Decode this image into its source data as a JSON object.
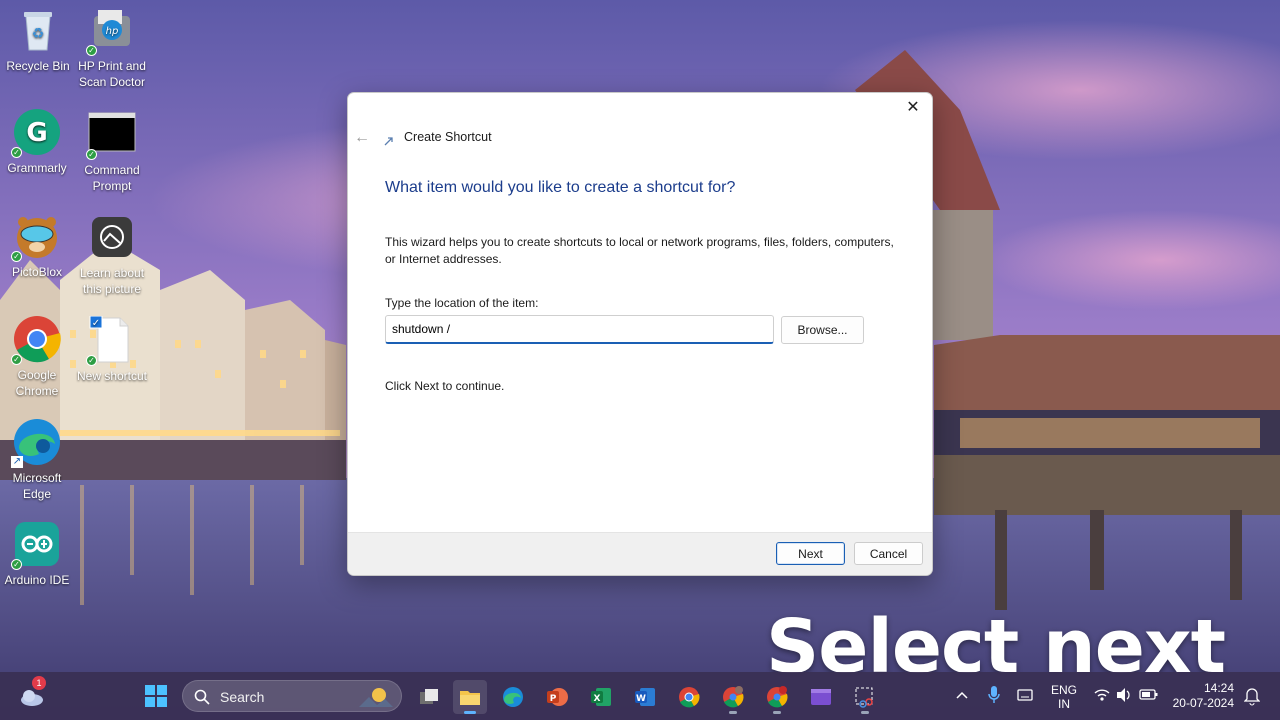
{
  "desktop": {
    "icons": [
      {
        "label": "Recycle Bin",
        "icon": "recycle-bin-icon"
      },
      {
        "label": "HP Print and Scan Doctor",
        "icon": "hp-print-scan-icon"
      },
      {
        "label": "Grammarly",
        "icon": "grammarly-icon"
      },
      {
        "label": "Command Prompt",
        "icon": "command-prompt-icon"
      },
      {
        "label": "PictoBlox",
        "icon": "pictoblox-icon"
      },
      {
        "label": "Learn about this picture",
        "icon": "camera-icon"
      },
      {
        "label": "Google Chrome",
        "icon": "chrome-icon"
      },
      {
        "label": "New shortcut",
        "icon": "blank-file-icon"
      },
      {
        "label": "Microsoft Edge",
        "icon": "edge-icon"
      },
      {
        "label": "Arduino IDE",
        "icon": "arduino-icon"
      }
    ]
  },
  "dialog": {
    "close_glyph": "✕",
    "back_glyph": "←",
    "title": "Create Shortcut",
    "heading": "What item would you like to create a shortcut for?",
    "description": "This wizard helps you to create shortcuts to local or network programs, files, folders, computers, or Internet addresses.",
    "location_label": "Type the location of the item:",
    "location_value": "shutdown /",
    "browse_label": "Browse...",
    "hint": "Click Next to continue.",
    "next_label": "Next",
    "cancel_label": "Cancel"
  },
  "overlay": {
    "caption": "Select next"
  },
  "taskbar": {
    "widgets_badge": "1",
    "search_label": "Search",
    "apps": [
      "task-view",
      "file-explorer",
      "edge",
      "powerpoint",
      "excel",
      "word",
      "chrome",
      "chrome-profile",
      "chrome-profile-2",
      "video-editor",
      "snipping-tool"
    ],
    "active_app": "file-explorer",
    "language": {
      "line1": "ENG",
      "line2": "IN"
    },
    "clock": {
      "time": "14:24",
      "date": "20-07-2024"
    }
  },
  "colors": {
    "accent": "#1a5fb4",
    "heading": "#1c3d8c",
    "taskbar": "#3a3054",
    "wallpaper_sky": "#7a6db8"
  }
}
